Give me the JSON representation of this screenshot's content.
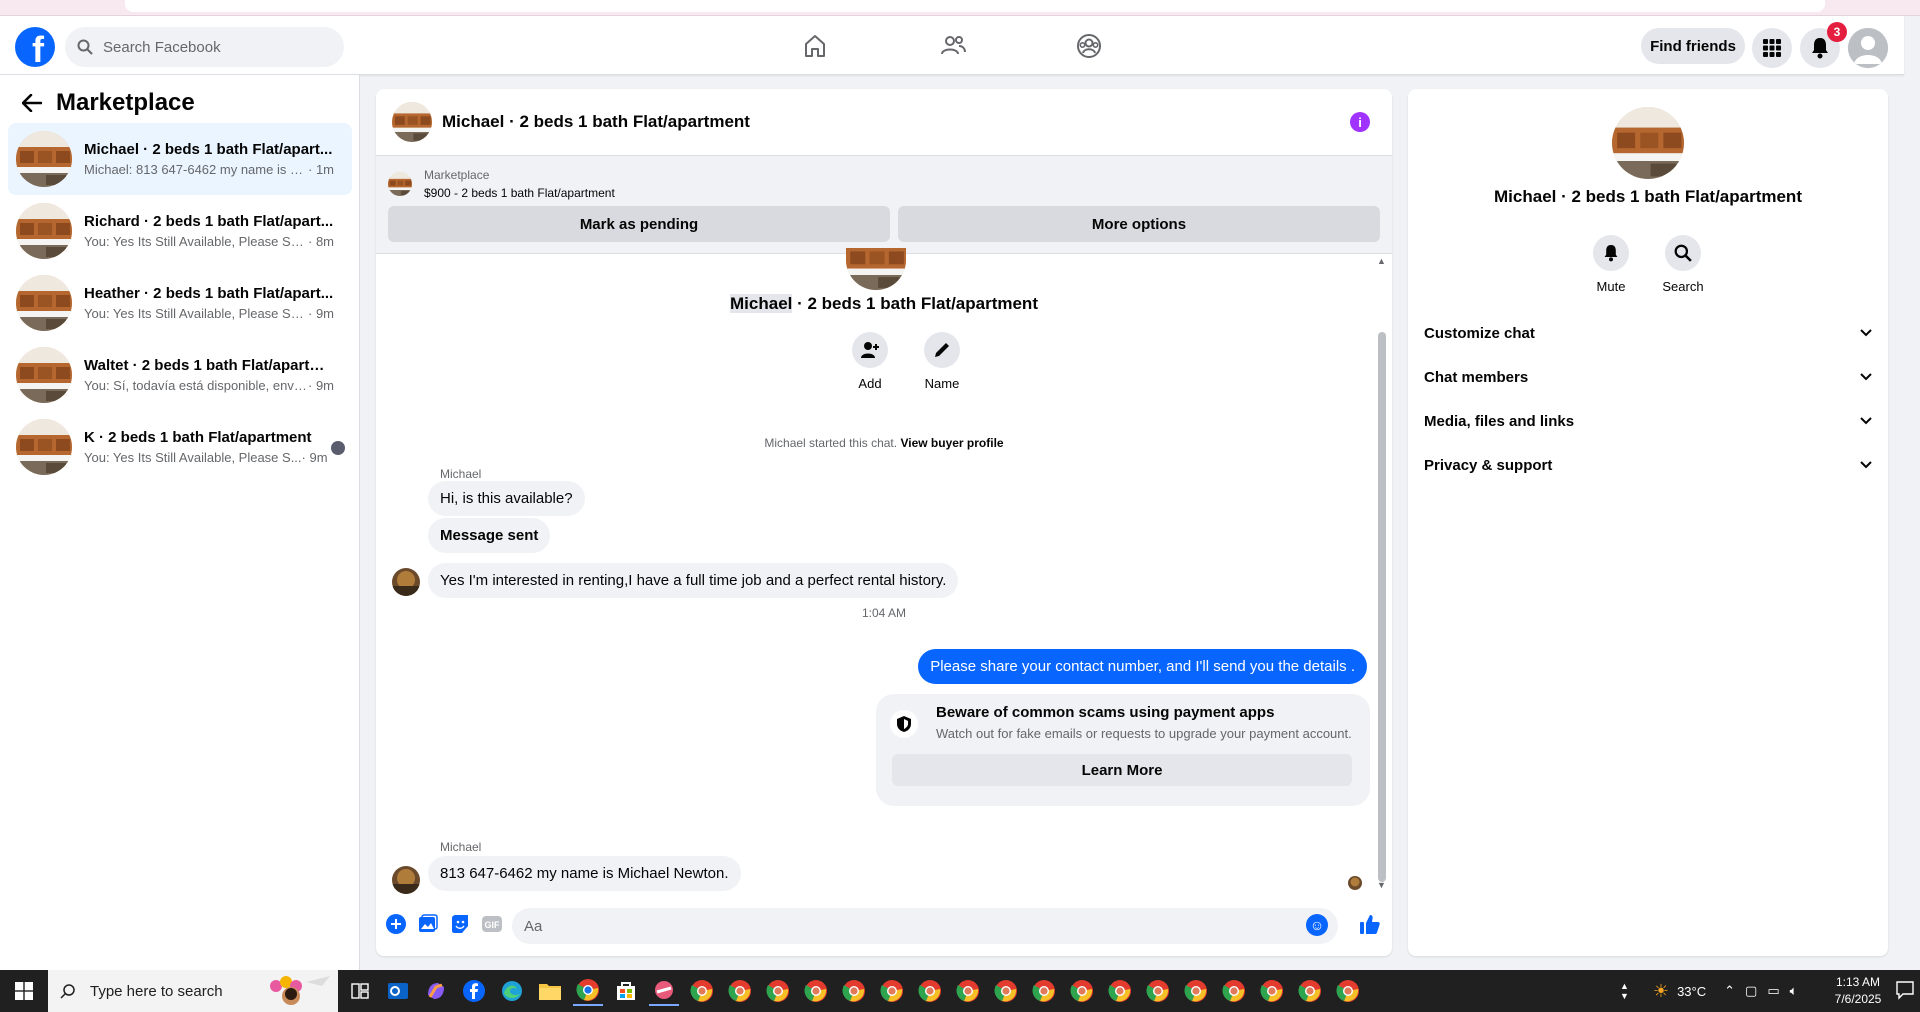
{
  "topnav": {
    "search_placeholder": "Search Facebook",
    "find_friends": "Find friends",
    "notification_count": "3"
  },
  "sidebar": {
    "title": "Marketplace",
    "conversations": [
      {
        "title": "Michael · 2 beds 1 bath Flat/apart...",
        "preview": "Michael: 813 647-6462 my name is M...",
        "time": "· 1m",
        "active": true
      },
      {
        "title": "Richard · 2 beds 1 bath Flat/apart...",
        "preview": "You: Yes Its Still Available, Please Sen...",
        "time": "· 8m"
      },
      {
        "title": "Heather · 2 beds 1 bath Flat/apart...",
        "preview": "You: Yes Its Still Available, Please Sen...",
        "time": "· 9m"
      },
      {
        "title": "Waltet · 2 beds 1 bath Flat/apartm...",
        "preview": "You: Sí, todavía está disponible, envíe...",
        "time": "· 9m"
      },
      {
        "title": "K · 2 beds 1 bath Flat/apartment",
        "preview": "You: Yes Its Still Available, Please S...",
        "time": "· 9m",
        "unread": true
      }
    ]
  },
  "chat": {
    "header_title": "Michael · 2 beds 1 bath Flat/apartment",
    "listing": {
      "category": "Marketplace",
      "price_title": "$900 - 2 beds 1 bath Flat/apartment",
      "mark_pending": "Mark as pending",
      "more_options": "More options"
    },
    "intro": {
      "name_highlight": "Michael",
      "name_rest": " · 2 beds 1 bath Flat/apartment",
      "add_label": "Add",
      "name_label": "Name",
      "started": "Michael started this chat.",
      "view_profile": "View buyer profile"
    },
    "messages": {
      "sender1": "Michael",
      "m1": "Hi, is this available?",
      "m2": "Message sent",
      "m3": "Yes I'm interested in renting,I have a full time job and a perfect rental history.",
      "time": "1:04 AM",
      "m4": "Please share your contact number, and I'll send you the details .",
      "scam_title": "Beware of common scams using payment apps",
      "scam_sub": "Watch out for fake emails or requests to upgrade your payment account.",
      "learn_more": "Learn More",
      "sender2": "Michael",
      "m5": "813 647-6462 my name is Michael Newton."
    },
    "composer_placeholder": "Aa"
  },
  "info_panel": {
    "title": "Michael · 2 beds 1 bath Flat/apartment",
    "mute": "Mute",
    "search": "Search",
    "sections": [
      "Customize chat",
      "Chat members",
      "Media, files and links",
      "Privacy & support"
    ]
  },
  "taskbar": {
    "search_placeholder": "Type here to search",
    "temperature": "33°C",
    "time": "1:13 AM",
    "date": "7/6/2025"
  },
  "colors": {
    "brand": "#0866ff",
    "out_bubble": "#0866ff",
    "in_bubble": "#f0f2f5",
    "badge": "#e41e3f",
    "info": "#a033ff"
  }
}
